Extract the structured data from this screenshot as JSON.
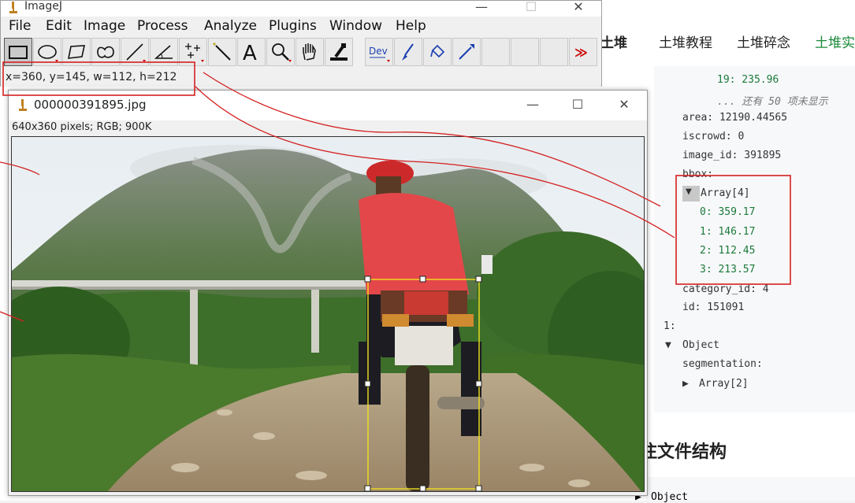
{
  "imagej": {
    "title": "ImageJ",
    "menu": [
      "File",
      "Edit",
      "Image",
      "Process",
      "Analyze",
      "Plugins",
      "Window",
      "Help"
    ],
    "tools": [
      "rectangle-tool",
      "oval-tool",
      "polygon-tool",
      "freehand-tool",
      "line-tool",
      "angle-tool",
      "point-tool",
      "wand-tool",
      "text-tool",
      "magnifier-tool",
      "hand-tool",
      "color-picker-tool",
      "dev-tool",
      "brush-tool",
      "flood-fill-tool",
      "pencil-tool",
      "empty-slot",
      "empty-slot",
      "empty-slot",
      "more-tools"
    ],
    "dev_label": "Dev",
    "status": "x=360, y=145, w=112, h=212"
  },
  "image_window": {
    "title": "000000391895.jpg",
    "info": "640x360 pixels; RGB; 900K"
  },
  "web": {
    "nav": [
      "土堆",
      "土堆教程",
      "土堆碎念",
      "土堆实"
    ],
    "json_lines": [
      {
        "indent": 0,
        "text": "19: 235.96",
        "type": "num"
      },
      {
        "indent": 0,
        "text": "... 还有 50 项未显示",
        "type": "hint"
      },
      {
        "indent": 0,
        "text": "area: 12190.44565",
        "type": "kv"
      },
      {
        "indent": 0,
        "text": "iscrowd: 0",
        "type": "kv"
      },
      {
        "indent": 0,
        "text": "image_id: 391895",
        "type": "kv"
      },
      {
        "indent": 0,
        "text": "bbox:",
        "type": "key"
      },
      {
        "indent": 0,
        "text": "Array[4]",
        "type": "arr"
      },
      {
        "indent": 0,
        "text": "0: 359.17",
        "type": "num"
      },
      {
        "indent": 0,
        "text": "1: 146.17",
        "type": "num"
      },
      {
        "indent": 0,
        "text": "2: 112.45",
        "type": "num"
      },
      {
        "indent": 0,
        "text": "3: 213.57",
        "type": "num"
      },
      {
        "indent": 0,
        "text": "category_id: 4",
        "type": "kv"
      },
      {
        "indent": 0,
        "text": "id: 151091",
        "type": "kv"
      },
      {
        "indent": 0,
        "text": "1:",
        "type": "key"
      },
      {
        "indent": 0,
        "text": "Object",
        "type": "obj"
      },
      {
        "indent": 0,
        "text": "segmentation:",
        "type": "key"
      },
      {
        "indent": 0,
        "text": "Array[2]",
        "type": "arr"
      }
    ],
    "heading": "注文件结构",
    "bottom_code": "Object"
  },
  "colors": {
    "annotation_red": "#d42020",
    "selection_yellow": "#f0e020",
    "green_value": "#1b7a3a"
  }
}
